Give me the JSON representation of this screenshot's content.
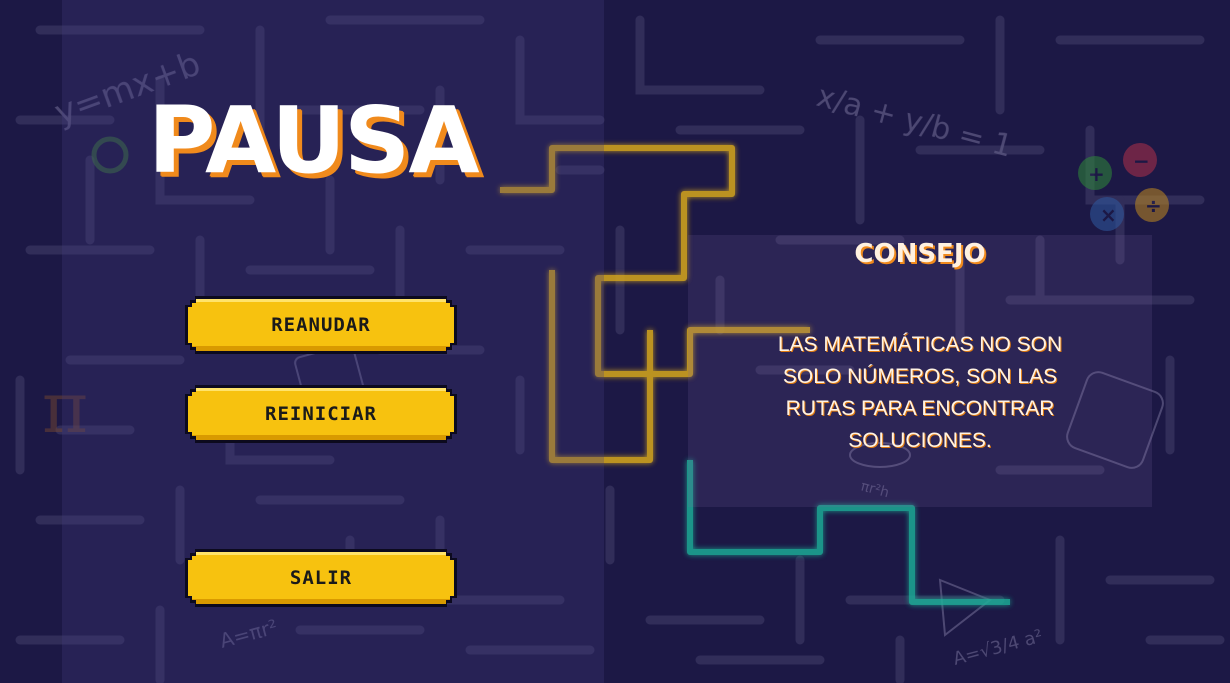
{
  "pause_menu": {
    "title": "PAUSA",
    "buttons": {
      "resume_label": "REANUDAR",
      "restart_label": "REINICIAR",
      "exit_label": "SALIR"
    }
  },
  "tip": {
    "title": "CONSEJO",
    "text": "LAS MATEMÁTICAS NO SON SOLO NÚMEROS, SON LAS RUTAS PARA ENCONTRAR SOLUCIONES."
  },
  "background": {
    "formulas": [
      "y=mx+b",
      "x/a + y/b = 1",
      "A=πr²",
      "A=√3/4 a²",
      "πr²h",
      "π"
    ],
    "icons": [
      "maze-pattern",
      "math-operators-icon",
      "calculator-icon",
      "dice-icon",
      "triangle-icon",
      "cylinder-icon"
    ]
  },
  "colors": {
    "background": "#1c1845",
    "button": "#f7c20f",
    "title_shadow": "#f08a1c",
    "path_yellow": "#d8a91a",
    "path_teal": "#1fb59a"
  }
}
